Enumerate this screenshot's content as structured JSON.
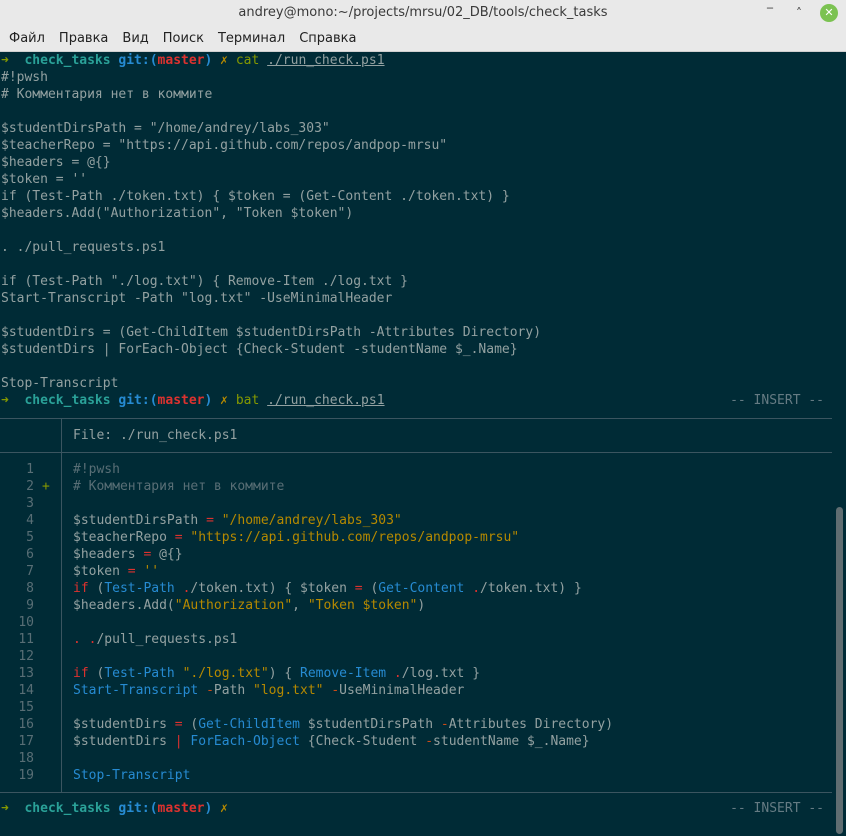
{
  "window": {
    "title": "andrey@mono:~/projects/mrsu/02_DB/tools/check_tasks",
    "controls": {
      "minimize": "‾",
      "maximize": "˄",
      "close": "✕"
    }
  },
  "menu": [
    "Файл",
    "Правка",
    "Вид",
    "Поиск",
    "Терминал",
    "Справка"
  ],
  "prompt": {
    "arrow": "➜",
    "dir": "check_tasks",
    "git": "git:(",
    "branch": "master",
    "git_close": ")",
    "dirty": "✗"
  },
  "cmd1": {
    "command": "cat",
    "arg": "./run_check.ps1"
  },
  "cat_output": [
    "#!pwsh",
    "# Комментария нет в коммите",
    "",
    "$studentDirsPath = \"/home/andrey/labs_303\"",
    "$teacherRepo = \"https://api.github.com/repos/andpop-mrsu\"",
    "$headers = @{}",
    "$token = ''",
    "if (Test-Path ./token.txt) { $token = (Get-Content ./token.txt) }",
    "$headers.Add(\"Authorization\", \"Token $token\")",
    "",
    ". ./pull_requests.ps1",
    "",
    "if (Test-Path \"./log.txt\") { Remove-Item ./log.txt }",
    "Start-Transcript -Path \"log.txt\" -UseMinimalHeader",
    "",
    "$studentDirs = (Get-ChildItem $studentDirsPath -Attributes Directory)",
    "$studentDirs | ForEach-Object {Check-Student -studentName $_.Name}",
    "",
    "Stop-Transcript"
  ],
  "cmd2": {
    "command": "bat",
    "arg": "./run_check.ps1",
    "mode": "-- INSERT --"
  },
  "bat": {
    "file_header": "File: ./run_check.ps1",
    "line_numbers": [
      "1",
      "2",
      "3",
      "4",
      "5",
      "6",
      "7",
      "8",
      "9",
      "10",
      "11",
      "12",
      "13",
      "14",
      "15",
      "16",
      "17",
      "18",
      "19"
    ],
    "git_marker": "+"
  },
  "final_prompt": {
    "mode": "-- INSERT --"
  },
  "colors": {
    "background": "#002b36",
    "text": "#93a1a1",
    "green": "#859900",
    "cyan": "#2aa198",
    "blue": "#268bd2",
    "red": "#dc322f",
    "yellow": "#b58900"
  }
}
